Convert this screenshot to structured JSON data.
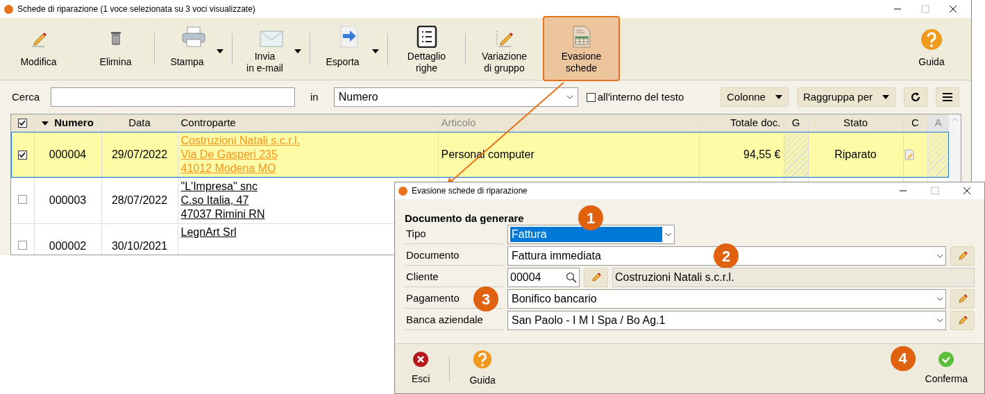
{
  "window": {
    "title": "Schede di riparazione (1 voce selezionata su 3 voci visualizzate)"
  },
  "toolbar": [
    {
      "label": "Modifica",
      "dropdown": false,
      "separator": false,
      "selected": false
    },
    {
      "label": "Elimina",
      "dropdown": false,
      "separator": false,
      "selected": false
    },
    {
      "label": "Stampa",
      "dropdown": true,
      "separator": true,
      "selected": false
    },
    {
      "label": "Invia\nin e-mail",
      "dropdown": true,
      "separator": true,
      "selected": false
    },
    {
      "label": "Esporta",
      "dropdown": true,
      "separator": true,
      "selected": false
    },
    {
      "label": "Dettaglio\nrighe",
      "dropdown": false,
      "separator": true,
      "selected": false
    },
    {
      "label": "Variazione\ndi gruppo",
      "dropdown": false,
      "separator": true,
      "selected": false
    },
    {
      "label": "Evasione\nschede",
      "dropdown": false,
      "separator": false,
      "selected": true
    }
  ],
  "help_button": {
    "label": "Guida"
  },
  "search": {
    "label": "Cerca",
    "in_label": "in",
    "field": "Numero",
    "inside_text": {
      "label": "all'interno del testo",
      "checked": false
    },
    "buttons": [
      "Colonne",
      "Raggruppa per"
    ]
  },
  "table": {
    "all_checked": true,
    "columns": [
      "Numero",
      "Data",
      "Controparte",
      "Articolo",
      "Totale doc.",
      "G",
      "Stato",
      "C",
      "A"
    ],
    "rows": [
      {
        "checked": true,
        "selected": true,
        "numero": "000004",
        "data": "29/07/2022",
        "controparte": [
          "Costruzioni Natali s.c.r.l.",
          "Via De Gasperi 235",
          "41012 Modena MO"
        ],
        "articolo": "Personal computer",
        "totale": "94,55 €",
        "stato": "Riparato"
      },
      {
        "checked": false,
        "selected": false,
        "numero": "000003",
        "data": "28/07/2022",
        "controparte": [
          "\"L'Impresa\" snc",
          "C.so Italia, 47",
          "47037 Rimini RN"
        ]
      },
      {
        "checked": false,
        "selected": false,
        "numero": "000002",
        "data": "30/10/2021",
        "controparte": [
          "LegnArt Srl"
        ]
      }
    ]
  },
  "dialog": {
    "title": "Evasione schede di riparazione",
    "section": "Documento da generare",
    "fields": [
      {
        "label": "Tipo",
        "kind": "select-short",
        "value": "Fattura",
        "highlighted": true,
        "edit": false,
        "marker": "1"
      },
      {
        "label": "Documento",
        "kind": "select",
        "value": "Fattura immediata",
        "edit": true,
        "marker": "2"
      },
      {
        "label": "Cliente",
        "kind": "lookup",
        "value": "00004",
        "name": "Costruzioni Natali s.c.r.l.",
        "edit": true
      },
      {
        "label": "Pagamento",
        "kind": "select",
        "value": "Bonifico bancario",
        "edit": true,
        "marker": "3"
      },
      {
        "label": "Banca aziendale",
        "kind": "select",
        "value": "San Paolo - I M I Spa / Bo Ag.1",
        "edit": true
      }
    ],
    "buttons": [
      {
        "label": "Esci"
      },
      {
        "label": "Guida"
      },
      {
        "label": "Conferma",
        "marker": "4"
      }
    ]
  }
}
